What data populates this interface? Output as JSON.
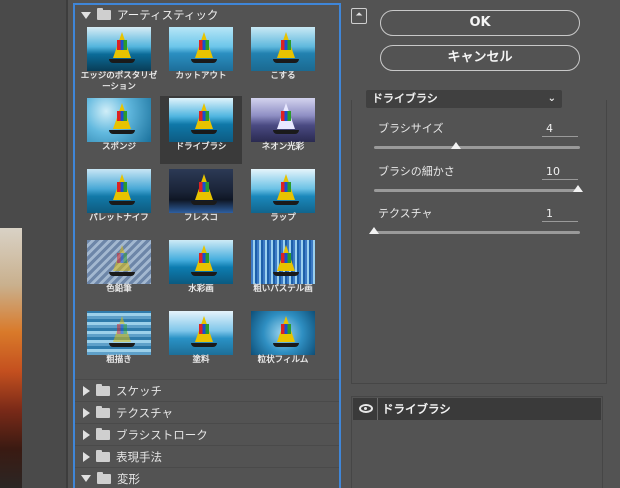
{
  "gallery": {
    "expanded_category": "アーティスティック",
    "thumbnails": [
      {
        "label": "エッジのポスタリゼーション",
        "style": "poster"
      },
      {
        "label": "カットアウト",
        "style": "cutout"
      },
      {
        "label": "こする",
        "style": "smudge"
      },
      {
        "label": "スポンジ",
        "style": "sponge"
      },
      {
        "label": "ドライブラシ",
        "style": "drybrush"
      },
      {
        "label": "ネオン光彩",
        "style": "neon"
      },
      {
        "label": "パレットナイフ",
        "style": "palette"
      },
      {
        "label": "フレスコ",
        "style": "fresco"
      },
      {
        "label": "ラップ",
        "style": "wrap"
      },
      {
        "label": "色鉛筆",
        "style": "pencil"
      },
      {
        "label": "水彩画",
        "style": "watercolor"
      },
      {
        "label": "粗いパステル画",
        "style": "pastel"
      },
      {
        "label": "粗描き",
        "style": "rough"
      },
      {
        "label": "塗料",
        "style": "paint"
      },
      {
        "label": "粒状フィルム",
        "style": "grain"
      }
    ],
    "selected_index": 4,
    "collapsed_categories": [
      "スケッチ",
      "テクスチャ",
      "ブラシストローク",
      "表現手法",
      "変形"
    ]
  },
  "buttons": {
    "ok": "OK",
    "cancel": "キャンセル",
    "collapse_icon": "collapse-icon"
  },
  "filter_select": {
    "value": "ドライブラシ",
    "chevron": "⌄"
  },
  "params": [
    {
      "label": "ブラシサイズ",
      "value": "4",
      "fraction": 0.4
    },
    {
      "label": "ブラシの細かさ",
      "value": "10",
      "fraction": 1.0
    },
    {
      "label": "テクスチャ",
      "value": "1",
      "fraction": 0.0
    }
  ],
  "layers": {
    "row_label": "ドライブラシ",
    "visibility_icon": "eye-icon"
  },
  "colors": {
    "accent_border": "#3f86d8",
    "background": "#535353"
  }
}
